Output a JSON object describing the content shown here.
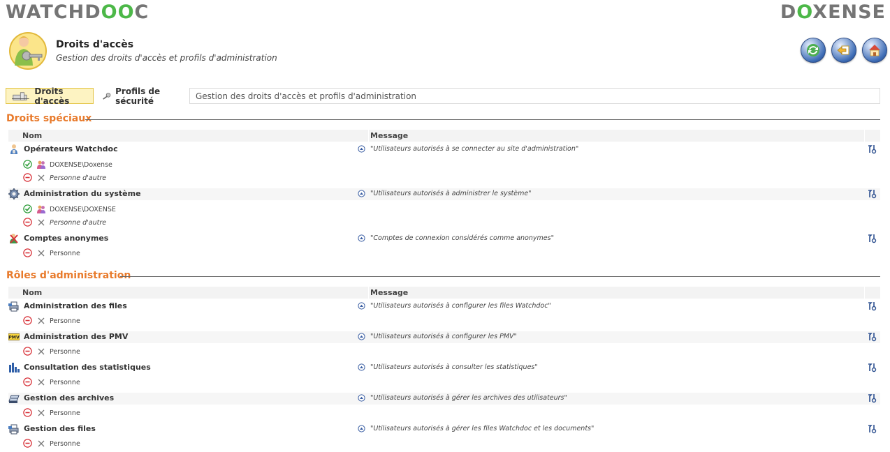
{
  "header": {
    "logo_left_a": "WATCHD",
    "logo_left_b": "OO",
    "logo_left_c": "C",
    "logo_right_a": "D",
    "logo_right_b": "O",
    "logo_right_c": "XENSE",
    "title": "Droits d'accès",
    "subtitle": "Gestion des droits d'accès et profils d'administration"
  },
  "tabs": {
    "access": "Droits d'accès",
    "profiles": "Profils de sécurité",
    "description": "Gestion des droits d'accès et profils d'administration"
  },
  "special": {
    "title": "Droits spéciaux",
    "col_name": "Nom",
    "col_message": "Message",
    "rows": [
      {
        "name": "Opérateurs Watchdoc",
        "message": "\"Utilisateurs autorisés à se connecter au site d'administration\"",
        "allow": "DOXENSE\\Doxense",
        "deny": "Personne d'autre"
      },
      {
        "name": "Administration du système",
        "message": "\"Utilisateurs autorisés à administrer le système\"",
        "allow": "DOXENSE\\DOXENSE",
        "deny": "Personne d'autre"
      },
      {
        "name": "Comptes anonymes",
        "message": "\"Comptes de connexion considérés comme anonymes\"",
        "deny": "Personne"
      }
    ]
  },
  "roles": {
    "title": "Rôles d'administration",
    "col_name": "Nom",
    "col_message": "Message",
    "rows": [
      {
        "name": "Administration des files",
        "message": "\"Utilisateurs autorisés à configurer les files Watchdoc\"",
        "deny": "Personne"
      },
      {
        "name": "Administration des PMV",
        "message": "\"Utilisateurs autorisés à configurer les PMV\"",
        "deny": "Personne",
        "icon_text": "PMV"
      },
      {
        "name": "Consultation des statistiques",
        "message": "\"Utilisateurs autorisés à consulter les statistiques\"",
        "deny": "Personne"
      },
      {
        "name": "Gestion des archives",
        "message": "\"Utilisateurs autorisés à gérer les archives des utilisateurs\"",
        "deny": "Personne"
      },
      {
        "name": "Gestion des files",
        "message": "\"Utilisateurs autorisés à gérer les files Watchdoc et les documents\"",
        "deny": "Personne"
      }
    ]
  },
  "colors": {
    "accent": "#e87a2b",
    "brand_green": "#4cb848",
    "logo_gray": "#757575",
    "tab_active": "#fdf3c2"
  }
}
